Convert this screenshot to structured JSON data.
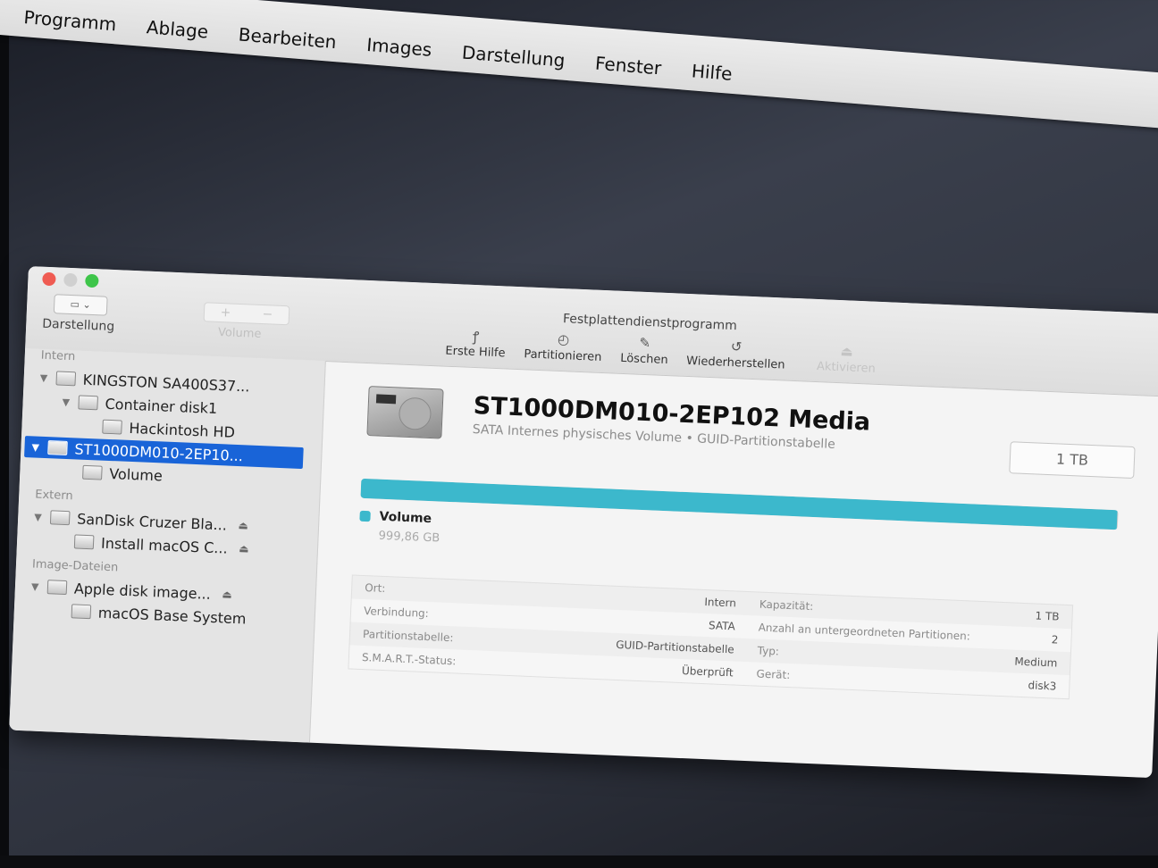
{
  "menubar": {
    "items": [
      "Programm",
      "Ablage",
      "Bearbeiten",
      "Images",
      "Darstellung",
      "Fenster",
      "Hilfe"
    ]
  },
  "window": {
    "title": "Festplattendienstprogramm",
    "toolbar": {
      "view_label": "Darstellung",
      "volume_label": "Volume",
      "volume_add": "+",
      "volume_remove": "−",
      "first_aid": "Erste Hilfe",
      "partition": "Partitionieren",
      "erase": "Löschen",
      "restore": "Wiederherstellen",
      "activate": "Aktivieren"
    }
  },
  "sidebar": {
    "sections": {
      "intern": "Intern",
      "extern": "Extern",
      "images": "Image-Dateien"
    },
    "items": [
      {
        "label": "KINGSTON SA400S37...",
        "level": 0,
        "expanded": true
      },
      {
        "label": "Container disk1",
        "level": 1,
        "expanded": true
      },
      {
        "label": "Hackintosh HD",
        "level": 2
      },
      {
        "label": "ST1000DM010-2EP10...",
        "level": 0,
        "expanded": true,
        "selected": true
      },
      {
        "label": "Volume",
        "level": 1
      },
      {
        "label": "SanDisk Cruzer Bla...",
        "level": 0,
        "expanded": true,
        "eject": true
      },
      {
        "label": "Install macOS C...",
        "level": 1,
        "eject": true
      },
      {
        "label": "Apple disk image...",
        "level": 0,
        "expanded": true,
        "eject": true
      },
      {
        "label": "macOS Base System",
        "level": 1
      }
    ]
  },
  "main": {
    "disk_title": "ST1000DM010-2EP102 Media",
    "disk_subtitle": "SATA Internes physisches Volume • GUID-Partitionstabelle",
    "size_badge": "1 TB",
    "usage_fraction": 0.999,
    "partition_name": "Volume",
    "partition_size": "999,86 GB",
    "partition_color": "#3cb8cc",
    "info_left": [
      {
        "label": "Ort:",
        "value": "Intern"
      },
      {
        "label": "Verbindung:",
        "value": "SATA"
      },
      {
        "label": "Partitionstabelle:",
        "value": "GUID-Partitionstabelle"
      },
      {
        "label": "S.M.A.R.T.-Status:",
        "value": "Überprüft"
      }
    ],
    "info_right": [
      {
        "label": "Kapazität:",
        "value": "1 TB"
      },
      {
        "label": "Anzahl an untergeordneten Partitionen:",
        "value": "2"
      },
      {
        "label": "Typ:",
        "value": "Medium"
      },
      {
        "label": "Gerät:",
        "value": "disk3"
      }
    ]
  }
}
